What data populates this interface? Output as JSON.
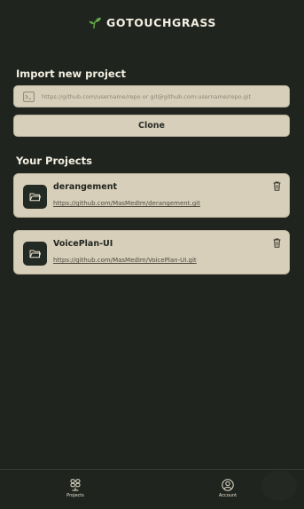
{
  "app": {
    "logo_text": "GOTOUCHGRASS"
  },
  "import": {
    "title": "Import new project",
    "placeholder": "https://github.com/username/repo or git@github.com:username/repo.git",
    "clone_label": "Clone"
  },
  "projects": {
    "title": "Your Projects",
    "items": [
      {
        "name": "derangement",
        "url": "https://github.com/MasMedIm/derangement.git"
      },
      {
        "name": "VoicePlan-UI",
        "url": "https://github.com/MasMedIm/VoicePlan-UI.git"
      }
    ]
  },
  "nav": {
    "projects_label": "Projects",
    "account_label": "Account"
  },
  "colors": {
    "background": "#1f241f",
    "card": "#d8cfba",
    "accent_green": "#6aa84f",
    "text_light": "#f4efe0"
  },
  "icons": [
    "sprout-icon",
    "terminal-icon",
    "folder-icon",
    "trash-icon",
    "projects-nav-icon",
    "account-icon"
  ]
}
